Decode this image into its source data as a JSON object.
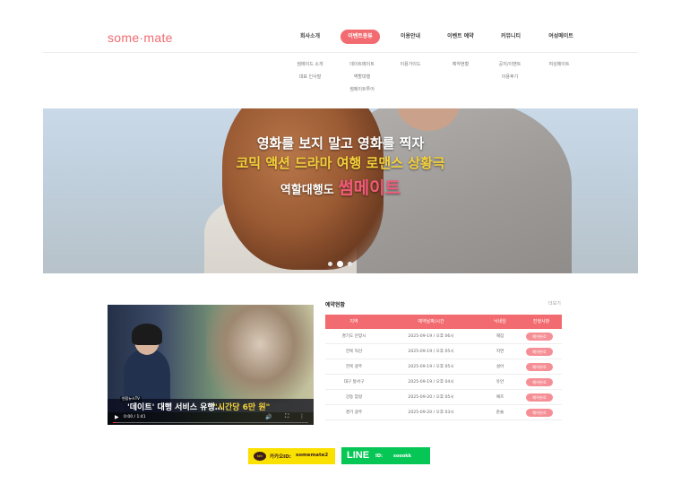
{
  "header": {
    "logo": "some·mate",
    "nav": [
      {
        "label": "회사소개",
        "active": false
      },
      {
        "label": "이벤트종류",
        "active": true
      },
      {
        "label": "이용안내",
        "active": false
      },
      {
        "label": "이벤트 예약",
        "active": false
      },
      {
        "label": "커뮤니티",
        "active": false
      },
      {
        "label": "여성메이트",
        "active": false
      }
    ],
    "submenu": [
      [
        "썸메이드 소개",
        "대표 인사말"
      ],
      [
        "데이트메이트",
        "역할대행",
        "썸메이트투어"
      ],
      [
        "이용가이드"
      ],
      [
        "예약현황"
      ],
      [
        "공지/이벤트",
        "이용후기"
      ],
      [
        "여성메이트"
      ]
    ]
  },
  "hero": {
    "line1": "영화를 보지 말고 영화를 찍자",
    "line2": "코믹 액션 드라마 여행 로맨스 상황극",
    "line3_prefix": "역할대행도",
    "line3_highlight": "썸메이트",
    "slide_count": 3,
    "active_slide": 2
  },
  "video": {
    "channel": "연합뉴스TV",
    "caption_a": "'데이트' 대행 서비스 유행…",
    "caption_b": "\"시간당 6만 원\"",
    "time": "0:00 / 1:41",
    "progress": 0.02
  },
  "reservations": {
    "title": "예약현황",
    "more": "더보기",
    "columns": [
      "지역",
      "예약날짜/시간",
      "닉네임",
      "진행사항"
    ],
    "rows": [
      {
        "region": "경기도 안양시",
        "datetime": "2025-09-19 / 오후 06시",
        "nickname": "해잠",
        "status": "예약완료"
      },
      {
        "region": "전북 익산",
        "datetime": "2025-09-19 / 오후 05시",
        "nickname": "지연",
        "status": "예약완료"
      },
      {
        "region": "전북 광주",
        "datetime": "2025-09-19 / 오후 05시",
        "nickname": "설아",
        "status": "예약완료"
      },
      {
        "region": "대구 달서구",
        "datetime": "2025-09-19 / 오후 04시",
        "nickname": "유안",
        "status": "예약완료"
      },
      {
        "region": "강동 암랑",
        "datetime": "2025-09-20 / 오후 05시",
        "nickname": "예즈",
        "status": "예약완료"
      },
      {
        "region": "경기 광주",
        "datetime": "2025-09-20 / 오후 03시",
        "nickname": "준슬",
        "status": "예약완료"
      }
    ]
  },
  "messengers": {
    "kakao_label": "카카오ID:",
    "kakao_id": "somemate2",
    "kakao_icon": "talk",
    "line_logo": "LINE",
    "line_label": "ID:",
    "line_id": "soookk"
  },
  "colors": {
    "accent": "#f26b70",
    "badge": "#f58f95",
    "kakao": "#fae100",
    "line": "#06c755",
    "hero_yellow": "#f5d13a",
    "hero_pink": "#f25a7a"
  }
}
